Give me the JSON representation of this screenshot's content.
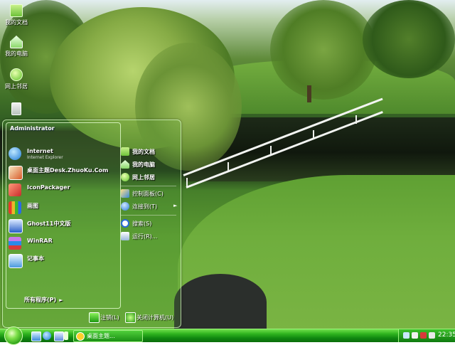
{
  "desktop": {
    "icons": [
      {
        "label": "我的文档",
        "icon": "folder-icon"
      },
      {
        "label": "我的电脑",
        "icon": "computer-icon"
      },
      {
        "label": "网上邻居",
        "icon": "network-icon"
      },
      {
        "label": "",
        "icon": "recycle-bin-icon"
      }
    ]
  },
  "start_menu": {
    "user": "Administrator",
    "pinned": [
      {
        "label": "Internet",
        "sub": "Internet Explorer",
        "icon": "ie-icon",
        "color": "#1e7ad6"
      },
      {
        "label": "桌面主题Desk.ZhuoKu.Com",
        "sub": "",
        "icon": "theme-icon",
        "color": "#d85a2a"
      },
      {
        "label": "IconPackager",
        "sub": "",
        "icon": "iconpackager-icon",
        "color": "#c92a2a"
      },
      {
        "label": "画图",
        "sub": "",
        "icon": "paint-icon",
        "color": "#e8b82a"
      },
      {
        "label": "Ghost11中文版",
        "sub": "",
        "icon": "ghost-icon",
        "color": "#2a5fc8"
      },
      {
        "label": "WinRAR",
        "sub": "",
        "icon": "winrar-icon",
        "color": "#8a2ab8"
      },
      {
        "label": "记事本",
        "sub": "",
        "icon": "notepad-icon",
        "color": "#4a9ae0"
      }
    ],
    "all_programs": "所有程序(P)",
    "places": [
      {
        "label": "我的文档",
        "icon": "folder-icon",
        "bold": true
      },
      {
        "label": "我的电脑",
        "icon": "computer-icon",
        "bold": true
      },
      {
        "label": "网上邻居",
        "icon": "network-icon",
        "bold": true
      },
      {
        "label": "控制面板(C)",
        "icon": "control-panel-icon",
        "bold": false
      },
      {
        "label": "连接到(T)",
        "icon": "connect-icon",
        "bold": false,
        "submenu": true
      },
      {
        "label": "搜索(S)",
        "icon": "search-icon",
        "bold": false
      },
      {
        "label": "运行(R)...",
        "icon": "run-icon",
        "bold": false
      }
    ],
    "footer": {
      "logoff": "注销(L)",
      "shutdown": "关闭计算机(U)"
    }
  },
  "taskbar": {
    "task": "桌面主题...",
    "clock": "22:35"
  }
}
